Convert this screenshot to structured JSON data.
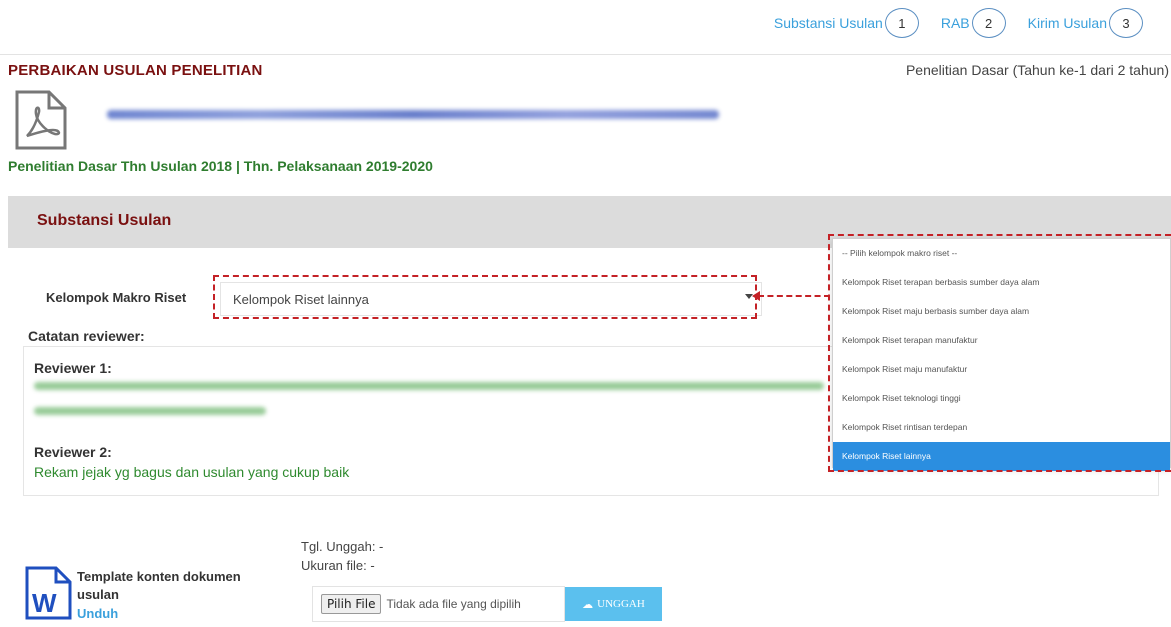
{
  "steps": [
    {
      "label": "Substansi Usulan",
      "num": "1"
    },
    {
      "label": "RAB",
      "num": "2"
    },
    {
      "label": "Kirim Usulan",
      "num": "3"
    }
  ],
  "header": {
    "title": "PERBAIKAN USULAN PENELITIAN",
    "scheme_info": "Penelitian Dasar (Tahun ke-1 dari 2 tahun)",
    "subtitle": "Penelitian Dasar Thn Usulan 2018 | Thn. Pelaksanaan 2019-2020"
  },
  "section": {
    "title": "Substansi Usulan"
  },
  "form": {
    "makro_label": "Kelompok Makro Riset",
    "makro_value": "Kelompok Riset lainnya",
    "makro_options": [
      "-- Pilih kelompok makro riset --",
      "Kelompok Riset terapan berbasis sumber daya alam",
      "Kelompok Riset maju berbasis sumber daya alam",
      "Kelompok Riset terapan manufaktur",
      "Kelompok Riset maju manufaktur",
      "Kelompok Riset teknologi tinggi",
      "Kelompok Riset rintisan terdepan",
      "Kelompok Riset lainnya"
    ],
    "selected_index": 7
  },
  "reviews": {
    "label": "Catatan reviewer:",
    "reviewer1_label": "Reviewer 1:",
    "reviewer2_label": "Reviewer 2:",
    "reviewer2_text": "Rekam jejak yg bagus dan usulan yang cukup baik"
  },
  "upload": {
    "date_label": "Tgl. Unggah: -",
    "size_label": "Ukuran file: -",
    "template_label": "Template konten dokumen usulan",
    "download_label": "Unduh",
    "choose_file_label": "Pilih File",
    "no_file_text": "Tidak ada file yang dipilih",
    "upload_button": "UNGGAH"
  },
  "colors": {
    "accent_blue": "#3aa0dc",
    "title_red": "#7a1010",
    "subtitle_green": "#2f7d2f",
    "highlight_dash": "#c42126",
    "selected_bg": "#2b8ee0",
    "upload_btn": "#5bc0ee"
  },
  "icons": [
    "pdf-file-icon",
    "word-file-icon",
    "cloud-upload-icon",
    "chevron-down-icon"
  ]
}
